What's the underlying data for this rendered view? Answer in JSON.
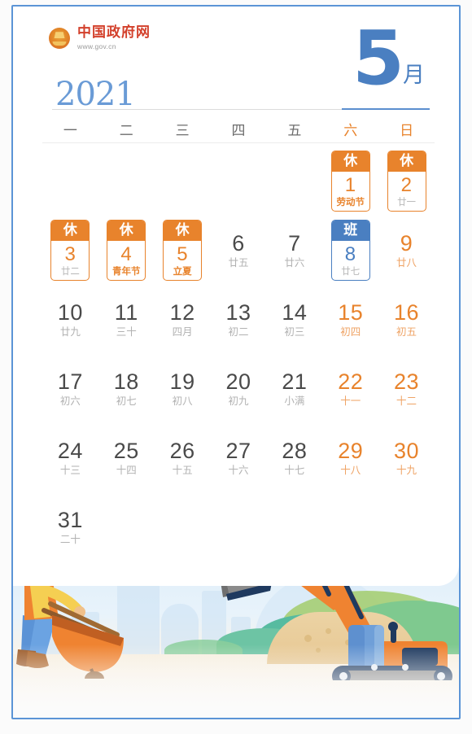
{
  "brand": {
    "emblem_icon": "national-emblem-icon",
    "name_cn": "中国政府网",
    "site_url": "www.gov.cn"
  },
  "header": {
    "year": "2021",
    "month_number": "5",
    "month_suffix": "月"
  },
  "colors": {
    "accent_orange": "#e8832c",
    "accent_blue": "#4a7fc1",
    "brand_red": "#d3402b",
    "weekday_gray": "#6d6d6d",
    "lunar_gray": "#b2b2b2",
    "frame_blue": "#5b94d6"
  },
  "weekdays": [
    {
      "label": "一",
      "weekend": false
    },
    {
      "label": "二",
      "weekend": false
    },
    {
      "label": "三",
      "weekend": false
    },
    {
      "label": "四",
      "weekend": false
    },
    {
      "label": "五",
      "weekend": false
    },
    {
      "label": "六",
      "weekend": true
    },
    {
      "label": "日",
      "weekend": true
    }
  ],
  "days": [
    {
      "blank": true
    },
    {
      "blank": true
    },
    {
      "blank": true
    },
    {
      "blank": true
    },
    {
      "blank": true
    },
    {
      "num": "1",
      "lunar": "劳动节",
      "weekend": true,
      "badge": "休",
      "badge_type": "rest",
      "festival": true
    },
    {
      "num": "2",
      "lunar": "廿一",
      "weekend": true,
      "badge": "休",
      "badge_type": "rest",
      "festival": false
    },
    {
      "num": "3",
      "lunar": "廿二",
      "weekend": false,
      "badge": "休",
      "badge_type": "rest",
      "festival": false
    },
    {
      "num": "4",
      "lunar": "青年节",
      "weekend": false,
      "badge": "休",
      "badge_type": "rest",
      "festival": true
    },
    {
      "num": "5",
      "lunar": "立夏",
      "weekend": false,
      "badge": "休",
      "badge_type": "rest",
      "festival": true
    },
    {
      "num": "6",
      "lunar": "廿五",
      "weekend": false
    },
    {
      "num": "7",
      "lunar": "廿六",
      "weekend": false
    },
    {
      "num": "8",
      "lunar": "廿七",
      "weekend": true,
      "badge": "班",
      "badge_type": "work",
      "festival": false
    },
    {
      "num": "9",
      "lunar": "廿八",
      "weekend": true
    },
    {
      "num": "10",
      "lunar": "廿九",
      "weekend": false
    },
    {
      "num": "11",
      "lunar": "三十",
      "weekend": false
    },
    {
      "num": "12",
      "lunar": "四月",
      "weekend": false
    },
    {
      "num": "13",
      "lunar": "初二",
      "weekend": false
    },
    {
      "num": "14",
      "lunar": "初三",
      "weekend": false
    },
    {
      "num": "15",
      "lunar": "初四",
      "weekend": true
    },
    {
      "num": "16",
      "lunar": "初五",
      "weekend": true
    },
    {
      "num": "17",
      "lunar": "初六",
      "weekend": false
    },
    {
      "num": "18",
      "lunar": "初七",
      "weekend": false
    },
    {
      "num": "19",
      "lunar": "初八",
      "weekend": false
    },
    {
      "num": "20",
      "lunar": "初九",
      "weekend": false
    },
    {
      "num": "21",
      "lunar": "小满",
      "weekend": false
    },
    {
      "num": "22",
      "lunar": "十一",
      "weekend": true
    },
    {
      "num": "23",
      "lunar": "十二",
      "weekend": true
    },
    {
      "num": "24",
      "lunar": "十三",
      "weekend": false
    },
    {
      "num": "25",
      "lunar": "十四",
      "weekend": false
    },
    {
      "num": "26",
      "lunar": "十五",
      "weekend": false
    },
    {
      "num": "27",
      "lunar": "十六",
      "weekend": false
    },
    {
      "num": "28",
      "lunar": "十七",
      "weekend": false
    },
    {
      "num": "29",
      "lunar": "十八",
      "weekend": true
    },
    {
      "num": "30",
      "lunar": "十九",
      "weekend": true
    },
    {
      "num": "31",
      "lunar": "二十",
      "weekend": false
    }
  ],
  "illustration": {
    "worker_icon": "construction-worker-with-wheelbarrow-icon",
    "excavator_icon": "excavator-icon",
    "city_icon": "city-skyline-icon",
    "hills_icon": "green-hills-icon",
    "sand_icon": "sand-pile-icon"
  }
}
